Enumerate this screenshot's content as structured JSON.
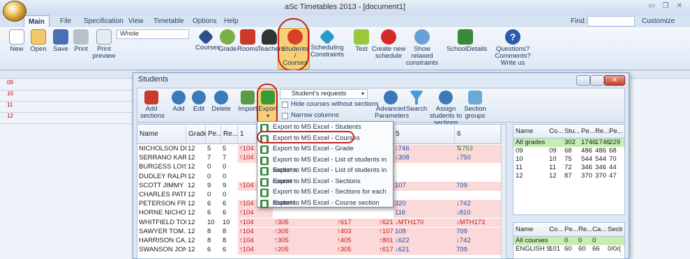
{
  "app": {
    "title": "aSc Timetables 2013  - [document1]"
  },
  "tabs": [
    "Main",
    "File",
    "Specification",
    "View",
    "Timetable",
    "Options",
    "Help"
  ],
  "find_label": "Find:",
  "customize_label": "Customize",
  "ribbon": {
    "buttons": [
      {
        "label": "New"
      },
      {
        "label": "Open"
      },
      {
        "label": "Save"
      },
      {
        "label": "Print"
      },
      {
        "label": "Print preview"
      },
      {
        "label": "Courses"
      },
      {
        "label": "Grade"
      },
      {
        "label": "Rooms"
      },
      {
        "label": "Teachers"
      },
      {
        "label": "Students / Courses"
      },
      {
        "label": "Scheduling Constraints"
      },
      {
        "label": "Test"
      },
      {
        "label": "Create new schedule"
      },
      {
        "label": "Show relaxed constraints"
      },
      {
        "label": "SchoolDetails"
      },
      {
        "label": "Questions? Comments? Write us"
      }
    ],
    "view_combo": "Whole"
  },
  "timetable_days": [
    "09",
    "10",
    "11",
    "12"
  ],
  "students_window": {
    "title": "Students",
    "buttons": [
      {
        "label": "Add sections"
      },
      {
        "label": "Add"
      },
      {
        "label": "Edit"
      },
      {
        "label": "Delete"
      },
      {
        "label": "Import"
      },
      {
        "label": "Export"
      },
      {
        "label": "Advanced Parameters"
      },
      {
        "label": "Search"
      },
      {
        "label": "Assign students to sections"
      },
      {
        "label": "Section groups"
      }
    ],
    "requests_combo": "Student's requests",
    "checkboxes": [
      "Hide courses without sections",
      "Narrow columns"
    ],
    "grid_headers": [
      "Name",
      "Grade",
      "Pe...",
      "Re...",
      "1",
      "5",
      "6"
    ],
    "rows": [
      {
        "name": "NICHOLSON DI...",
        "grade": "12",
        "pe": "5",
        "re": "5",
        "c1": "104",
        "c5": "746",
        "c6": "753"
      },
      {
        "name": "SERRANO KARL",
        "grade": "12",
        "pe": "7",
        "re": "7",
        "c1": "104",
        "c5": "308",
        "c6": "750"
      },
      {
        "name": "BURGESS LOIS",
        "grade": "12",
        "pe": "0",
        "re": "0",
        "c1": "",
        "c5": "",
        "c6": ""
      },
      {
        "name": "DUDLEY RALPH",
        "grade": "12",
        "pe": "0",
        "re": "0",
        "c1": "",
        "c5": "",
        "c6": ""
      },
      {
        "name": "SCOTT JIMMY",
        "grade": "12",
        "pe": "9",
        "re": "9",
        "c1": "104",
        "c5": "107",
        "c6": "709"
      },
      {
        "name": "CHARLES PATR...",
        "grade": "12",
        "pe": "0",
        "re": "0",
        "c1": "",
        "c5": "",
        "c6": ""
      },
      {
        "name": "PETERSON FRE...",
        "grade": "12",
        "pe": "6",
        "re": "6",
        "c1": "104",
        "c5": "320",
        "c6": "742"
      },
      {
        "name": "HORNE NICHO...",
        "grade": "12",
        "pe": "6",
        "re": "6",
        "c1": "104",
        "c5": "116",
        "c6": "810"
      },
      {
        "name": "WHITFIELD TONI",
        "grade": "12",
        "pe": "10",
        "re": "10",
        "c1": "104",
        "c2": "305",
        "c3": "617",
        "c4": "621",
        "c5": "MTH170",
        "c6": "MTH173"
      },
      {
        "name": "SAWYER TOM...",
        "grade": "12",
        "pe": "8",
        "re": "8",
        "c1": "104",
        "c2": "305",
        "c3": "403",
        "c4": "107",
        "c5": "108",
        "c6": "709"
      },
      {
        "name": "HARRISON CA...",
        "grade": "12",
        "pe": "8",
        "re": "8",
        "c1": "104",
        "c2": "305",
        "c3": "405",
        "c4": "801",
        "c5": "622",
        "c6": "742"
      },
      {
        "name": "SWANSON JON",
        "grade": "12",
        "pe": "6",
        "re": "6",
        "c1": "104",
        "c2": "205",
        "c3": "305",
        "c4": "617",
        "c5": "621",
        "c6": "709"
      }
    ],
    "export_menu": [
      "Export to MS Excel - Students",
      "Export to MS Excel - Courses",
      "Export to MS Excel - Grade",
      "Export to MS Excel - List of students in sections",
      "Export to MS Excel - List of students in course",
      "Export to MS Excel - Sections",
      "Export to MS Excel - Sections for each student",
      "Export to MS Excel - Course section"
    ],
    "grades_panel": {
      "headers": [
        "Name",
        "Co...",
        "Stu...",
        "Pe...",
        "Re...",
        "Pe..."
      ],
      "rows": [
        [
          "All grades",
          "",
          "302",
          "1746",
          "1746",
          "229"
        ],
        [
          "09",
          "09",
          "68",
          "486",
          "486",
          "68"
        ],
        [
          "10",
          "10",
          "75",
          "544",
          "544",
          "70"
        ],
        [
          "11",
          "11",
          "72",
          "346",
          "346",
          "44"
        ],
        [
          "12",
          "12",
          "87",
          "370",
          "370",
          "47"
        ]
      ]
    },
    "courses_panel": {
      "headers": [
        "Name",
        "Co...",
        "Pe...",
        "Re...",
        "Ca...",
        "Secti"
      ],
      "rows": [
        [
          "All courses",
          "",
          "0",
          "0",
          "0",
          ""
        ],
        [
          "ENGLISH 9",
          "101",
          "60",
          "60",
          "66",
          "0/0/("
        ]
      ]
    }
  }
}
